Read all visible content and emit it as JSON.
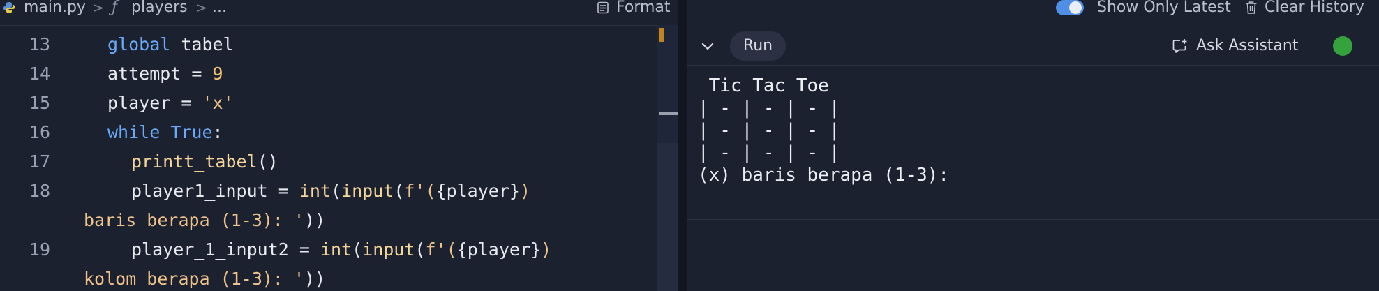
{
  "editor": {
    "breadcrumb": {
      "file": "main.py",
      "separator": ">",
      "function_icon": "ƒ",
      "function": "players",
      "more": "..."
    },
    "format_label": "Format",
    "lines": [
      {
        "number": "13",
        "tokens": [
          [
            "kw",
            "global"
          ],
          [
            "txt",
            " tabel"
          ]
        ]
      },
      {
        "number": "14",
        "tokens": [
          [
            "txt",
            "attempt = "
          ],
          [
            "num",
            "9"
          ]
        ]
      },
      {
        "number": "15",
        "tokens": [
          [
            "txt",
            "player = "
          ],
          [
            "str",
            "'x'"
          ]
        ]
      },
      {
        "number": "16",
        "tokens": [
          [
            "kw",
            "while"
          ],
          [
            "txt",
            " "
          ],
          [
            "kw",
            "True"
          ],
          [
            "txt",
            ":"
          ]
        ]
      },
      {
        "number": "17",
        "tokens": [
          [
            "fnc",
            "printt_tabel"
          ],
          [
            "txt",
            "()"
          ]
        ]
      },
      {
        "number": "18",
        "tokens": [
          [
            "txt",
            "player1_input = "
          ],
          [
            "bi",
            "int"
          ],
          [
            "txt",
            "("
          ],
          [
            "bi",
            "input"
          ],
          [
            "txt",
            "("
          ],
          [
            "str",
            "f'("
          ],
          [
            "txt",
            "{player}"
          ],
          [
            "str",
            ")"
          ]
        ]
      },
      {
        "number": "",
        "tokens": [
          [
            "str",
            "baris berapa (1-3): '"
          ],
          [
            "txt",
            "))"
          ]
        ]
      },
      {
        "number": "19",
        "tokens": [
          [
            "txt",
            "player_1_input2 = "
          ],
          [
            "bi",
            "int"
          ],
          [
            "txt",
            "("
          ],
          [
            "bi",
            "input"
          ],
          [
            "txt",
            "("
          ],
          [
            "str",
            "f'("
          ],
          [
            "txt",
            "{player}"
          ],
          [
            "str",
            ")"
          ]
        ]
      },
      {
        "number": "",
        "tokens": [
          [
            "str",
            "kolom berapa (1-3): '"
          ],
          [
            "txt",
            "))"
          ]
        ]
      }
    ]
  },
  "console": {
    "show_only_latest_label": "Show Only Latest",
    "show_only_latest_on": true,
    "clear_history_label": "Clear History",
    "run_label": "Run",
    "ask_assistant_label": "Ask Assistant",
    "status_color": "#36a23d",
    "output": " Tic Tac Toe\n| - | - | - |\n| - | - | - |\n| - | - | - |\n(x) baris berapa (1-3): "
  },
  "colors": {
    "background": "#1c2130",
    "keyword": "#6aaaf8",
    "number": "#f0c674",
    "string": "#f0c38c",
    "function": "#f6d79b",
    "toggle_on": "#4f8fe8"
  }
}
